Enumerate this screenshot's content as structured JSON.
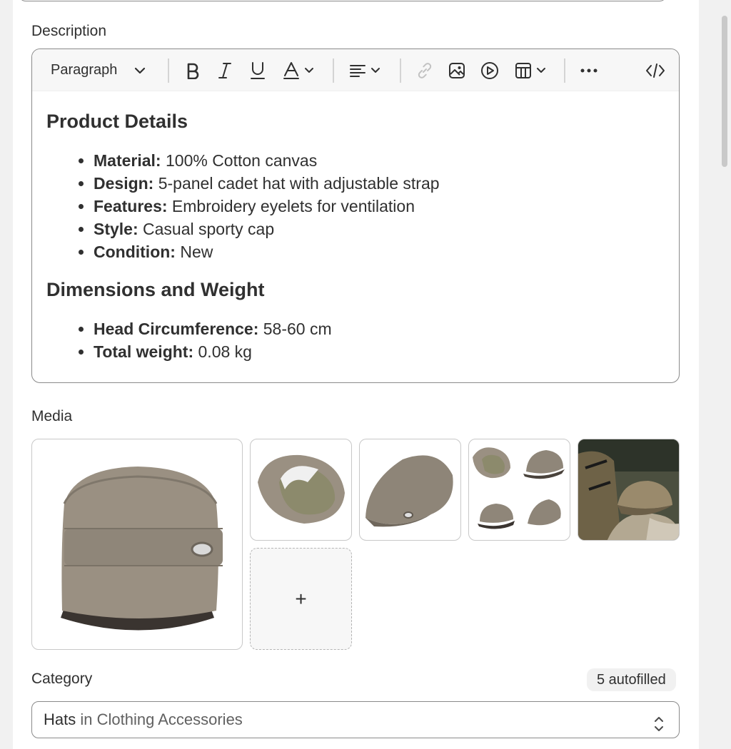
{
  "description": {
    "label": "Description",
    "toolbar": {
      "paragraph_label": "Paragraph"
    },
    "heading1": "Product Details",
    "details": [
      {
        "key": "Material:",
        "value": " 100% Cotton canvas"
      },
      {
        "key": "Design:",
        "value": " 5-panel cadet hat with adjustable strap"
      },
      {
        "key": "Features:",
        "value": " Embroidery eyelets for ventilation"
      },
      {
        "key": "Style:",
        "value": " Casual sporty cap"
      },
      {
        "key": "Condition:",
        "value": " New"
      }
    ],
    "heading2": "Dimensions and Weight",
    "dimensions": [
      {
        "key": "Head Circumference:",
        "value": " 58-60 cm"
      },
      {
        "key": "Total weight:",
        "value": " 0.08 kg"
      }
    ]
  },
  "media": {
    "label": "Media",
    "add_label": "+"
  },
  "category": {
    "label": "Category",
    "badge": "5 autofilled",
    "value_primary": "Hats",
    "value_secondary": " in Clothing Accessories"
  },
  "colors": {
    "cap_khaki": "#9a9082",
    "text": "#303030",
    "border": "#8a8a8a"
  }
}
